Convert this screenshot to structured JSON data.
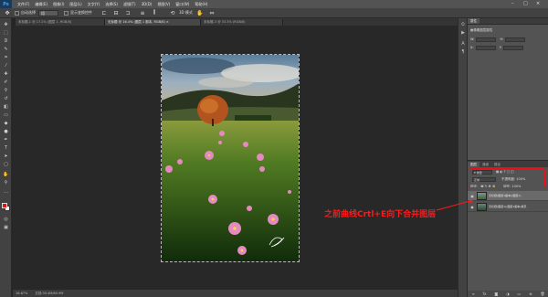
{
  "app": {
    "logo": "Ps"
  },
  "menu": {
    "items": [
      "文件(F)",
      "编辑(E)",
      "图像(I)",
      "图层(L)",
      "文字(Y)",
      "选择(S)",
      "滤镜(T)",
      "3D(D)",
      "视图(V)",
      "窗口(W)",
      "帮助(H)"
    ],
    "window_controls": [
      "–",
      "□",
      "×"
    ]
  },
  "options": {
    "tool_icon": "move-tool-icon",
    "auto_select_label": "自动选择",
    "auto_select_value": "组",
    "show_transform_label": "显示变换控件",
    "mode_3d": "3D 模式"
  },
  "tabs": [
    {
      "label": "未标题-1 @ 17.2% (图层 1, RGB/8)",
      "active": false
    },
    {
      "label": "无标题 @ 16.4% (图层 1 副本, RGB/8) ×",
      "active": true
    },
    {
      "label": "未标题-3 @ 33.3% (RGB/8)",
      "active": false
    }
  ],
  "status": {
    "zoom": "16.67%",
    "doc_info": "文档:30.4M/60.9M"
  },
  "colors": {
    "foreground": "#e0140f",
    "background": "#ffffff",
    "annotation": "#ff1a1a"
  },
  "properties": {
    "tab": "属性",
    "title": "像素图层属性",
    "w_label": "W:",
    "h_label": "H:",
    "x_label": "X:",
    "y_label": "Y:"
  },
  "layers_panel": {
    "tabs": [
      "图层",
      "通道",
      "路径"
    ],
    "kind_label": "P 类型",
    "blend_mode": "正常",
    "opacity_label": "不透明度: 100%",
    "lock_label": "锁定:",
    "fill_label": "填充: 100%",
    "layers": [
      {
        "name": "无标题(图层1副本)(图层1)",
        "selected": true,
        "visible": true
      },
      {
        "name": "无标题(图层1)(图层1副本)拷贝",
        "selected": false,
        "visible": true
      }
    ]
  },
  "annotation": {
    "text": "之前曲线Crtl+E向下合并图层"
  }
}
